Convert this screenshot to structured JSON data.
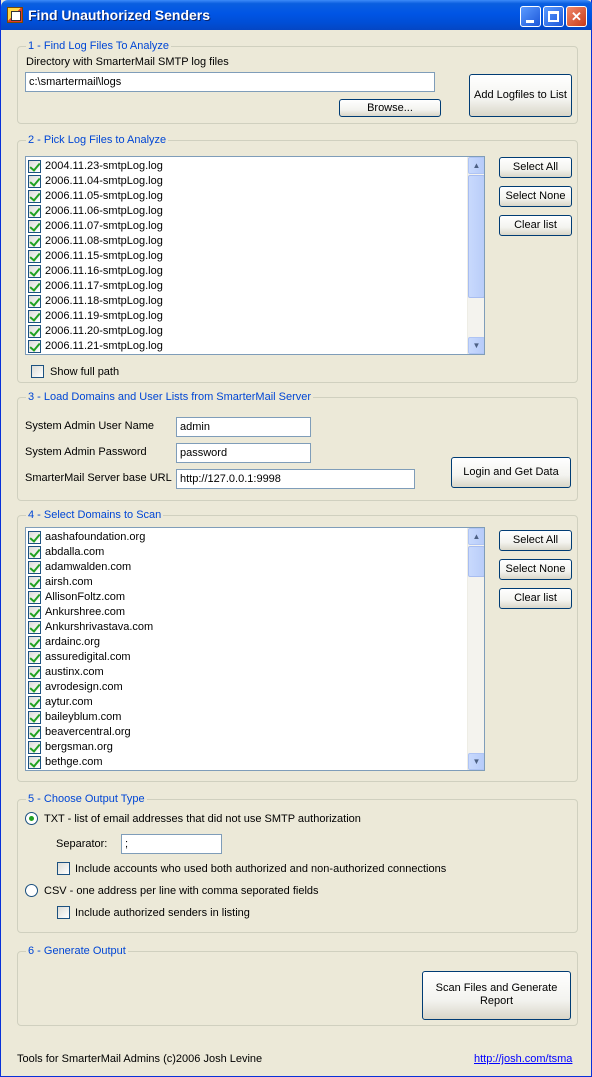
{
  "window": {
    "title": "Find Unauthorized Senders"
  },
  "section1": {
    "title": "1 - Find Log Files To Analyze",
    "dir_label": "Directory with SmarterMail SMTP log files",
    "dir_value": "c:\\smartermail\\logs",
    "browse_label": "Browse...",
    "add_label": "Add Logfiles to List"
  },
  "section2": {
    "title": "2 - Pick Log Files to Analyze",
    "files": [
      "2004.11.23-smtpLog.log",
      "2006.11.04-smtpLog.log",
      "2006.11.05-smtpLog.log",
      "2006.11.06-smtpLog.log",
      "2006.11.07-smtpLog.log",
      "2006.11.08-smtpLog.log",
      "2006.11.15-smtpLog.log",
      "2006.11.16-smtpLog.log",
      "2006.11.17-smtpLog.log",
      "2006.11.18-smtpLog.log",
      "2006.11.19-smtpLog.log",
      "2006.11.20-smtpLog.log",
      "2006.11.21-smtpLog.log"
    ],
    "select_all": "Select All",
    "select_none": "Select None",
    "clear_list": "Clear list",
    "show_full_path": "Show full path"
  },
  "section3": {
    "title": "3 - Load Domains and User Lists from SmarterMail Server",
    "user_label": "System Admin User Name",
    "user_value": "admin",
    "pass_label": "System Admin Password",
    "pass_value": "password",
    "url_label": "SmarterMail Server base URL",
    "url_value": "http://127.0.0.1:9998",
    "login_label": "Login and Get Data"
  },
  "section4": {
    "title": "4 - Select Domains to Scan",
    "domains": [
      "aashafoundation.org",
      "abdalla.com",
      "adamwalden.com",
      "airsh.com",
      "AllisonFoltz.com",
      "Ankurshree.com",
      "Ankurshrivastava.com",
      "ardainc.org",
      "assuredigital.com",
      "austinx.com",
      "avrodesign.com",
      "aytur.com",
      "baileyblum.com",
      "beavercentral.org",
      "bergsman.org",
      "bethge.com"
    ],
    "select_all": "Select All",
    "select_none": "Select None",
    "clear_list": "Clear list"
  },
  "section5": {
    "title": "5 - Choose Output Type",
    "txt_label": "TXT - list of email addresses that did not use SMTP authorization",
    "separator_label": "Separator:",
    "separator_value": ";",
    "include_both_label": "Include accounts who used both authorized and non-authorized connections",
    "csv_label": "CSV - one address per line with comma seporated fields",
    "include_authorized_label": "Include authorized senders in listing"
  },
  "section6": {
    "title": "6 - Generate Output",
    "scan_label": "Scan Files and Generate Report"
  },
  "footer": {
    "credit": "Tools for SmarterMail Admins (c)2006 Josh Levine",
    "link": "http://josh.com/tsma"
  }
}
